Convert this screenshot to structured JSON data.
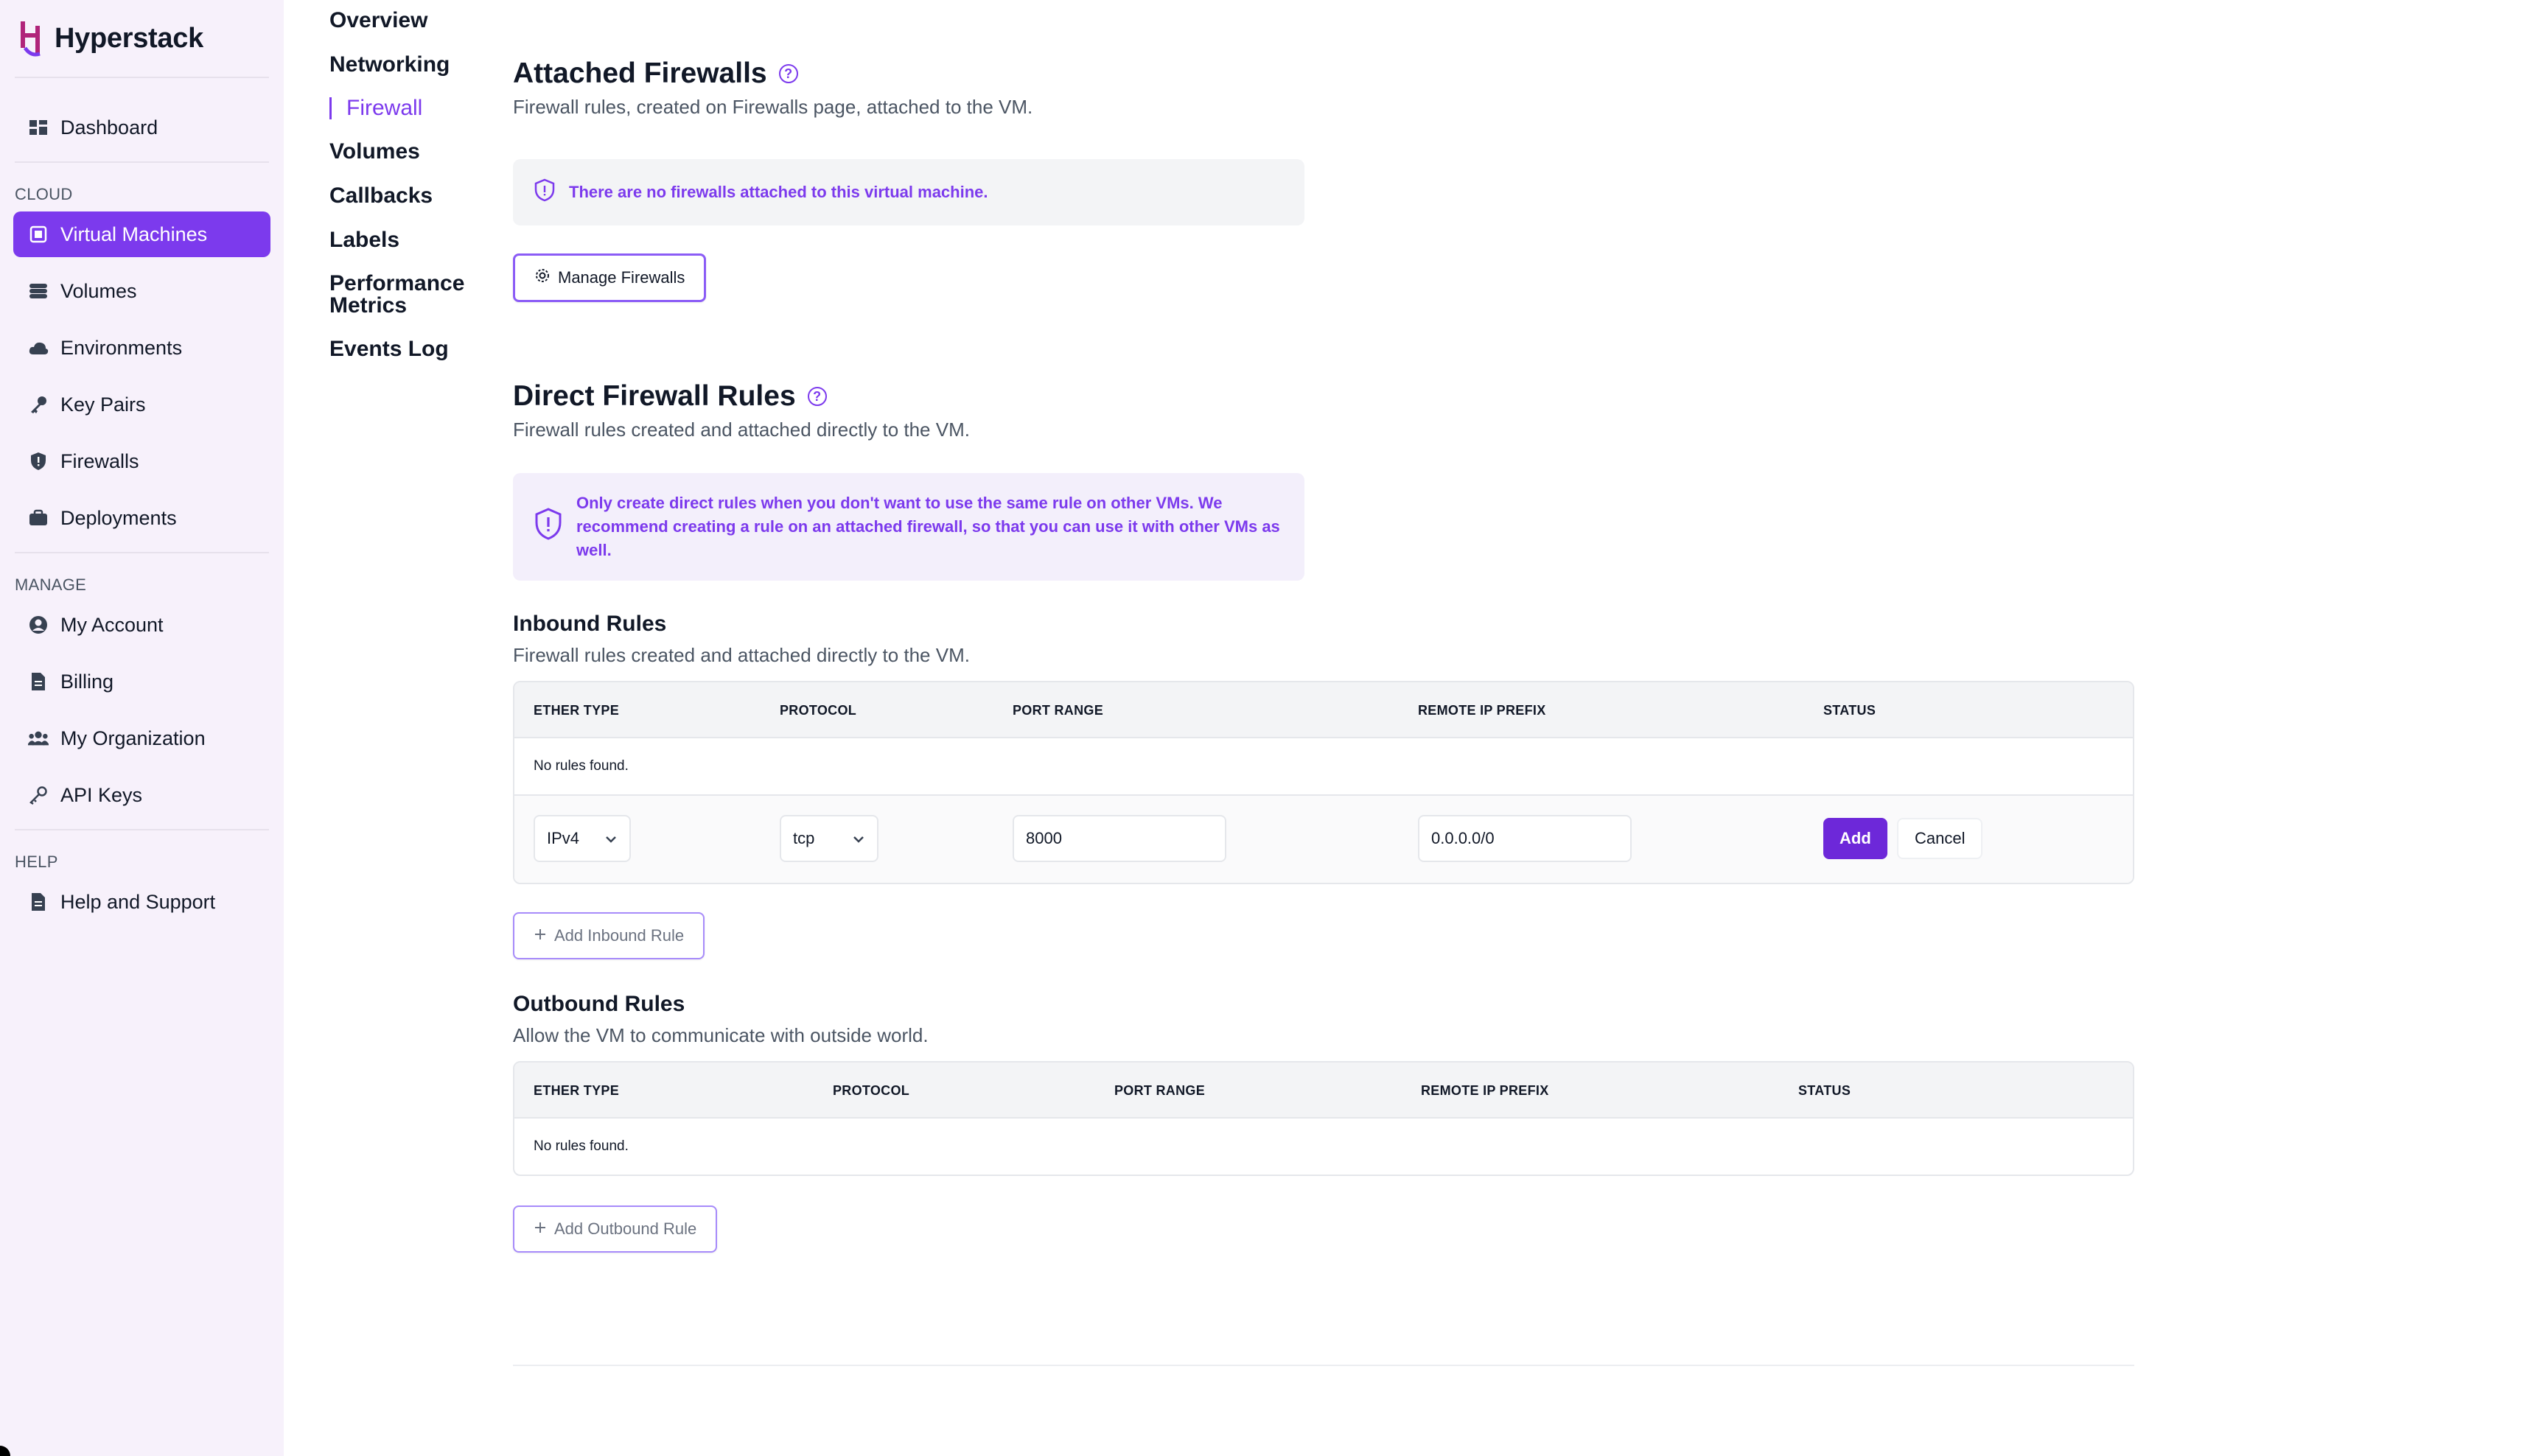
{
  "brand": {
    "name": "Hyperstack"
  },
  "sidebar": {
    "top_items": [
      {
        "label": "Dashboard",
        "icon": "dashboard-icon"
      }
    ],
    "sections": [
      {
        "title": "CLOUD",
        "items": [
          {
            "label": "Virtual Machines",
            "icon": "cpu-icon",
            "active": true
          },
          {
            "label": "Volumes",
            "icon": "database-icon"
          },
          {
            "label": "Environments",
            "icon": "cloud-icon"
          },
          {
            "label": "Key Pairs",
            "icon": "key-icon"
          },
          {
            "label": "Firewalls",
            "icon": "shield-icon"
          },
          {
            "label": "Deployments",
            "icon": "briefcase-icon"
          }
        ]
      },
      {
        "title": "MANAGE",
        "items": [
          {
            "label": "My Account",
            "icon": "user-circle-icon"
          },
          {
            "label": "Billing",
            "icon": "document-icon"
          },
          {
            "label": "My Organization",
            "icon": "users-icon"
          },
          {
            "label": "API Keys",
            "icon": "key-outline-icon"
          }
        ]
      },
      {
        "title": "HELP",
        "items": [
          {
            "label": "Help and Support",
            "icon": "document-icon"
          }
        ]
      }
    ]
  },
  "subnav": {
    "items": [
      "Overview",
      "Networking",
      "Firewall",
      "Volumes",
      "Callbacks",
      "Labels",
      "Performance Metrics",
      "Events Log"
    ],
    "active": "Firewall"
  },
  "attached": {
    "title": "Attached Firewalls",
    "subtitle": "Firewall rules, created on Firewalls page, attached to the VM.",
    "empty_message": "There are no firewalls attached to this virtual machine.",
    "manage_button": "Manage Firewalls"
  },
  "direct": {
    "title": "Direct Firewall Rules",
    "subtitle": "Firewall rules created and attached directly to the VM.",
    "warning": "Only create direct rules when you don't want to use the same rule on other VMs. We recommend creating a rule on an attached firewall, so that you can use it with other VMs as well."
  },
  "inbound": {
    "title": "Inbound Rules",
    "subtitle": "Firewall rules created and attached directly to the VM.",
    "columns": [
      "ETHER TYPE",
      "PROTOCOL",
      "PORT RANGE",
      "REMOTE IP PREFIX",
      "STATUS"
    ],
    "empty": "No rules found.",
    "new_rule": {
      "ether_type": "IPv4",
      "protocol": "tcp",
      "port_range": "8000",
      "remote_ip_prefix": "0.0.0.0/0",
      "add_label": "Add",
      "cancel_label": "Cancel"
    },
    "add_button": "Add Inbound Rule"
  },
  "outbound": {
    "title": "Outbound Rules",
    "subtitle": "Allow the VM to communicate with outside world.",
    "columns": [
      "ETHER TYPE",
      "PROTOCOL",
      "PORT RANGE",
      "REMOTE IP PREFIX",
      "STATUS"
    ],
    "empty": "No rules found.",
    "add_button": "Add Outbound Rule"
  },
  "colors": {
    "accent": "#7c3aed",
    "accent_dark": "#6d28d9",
    "sidebar_bg": "#f7f1fb",
    "brand_logo": "#b0247a"
  }
}
